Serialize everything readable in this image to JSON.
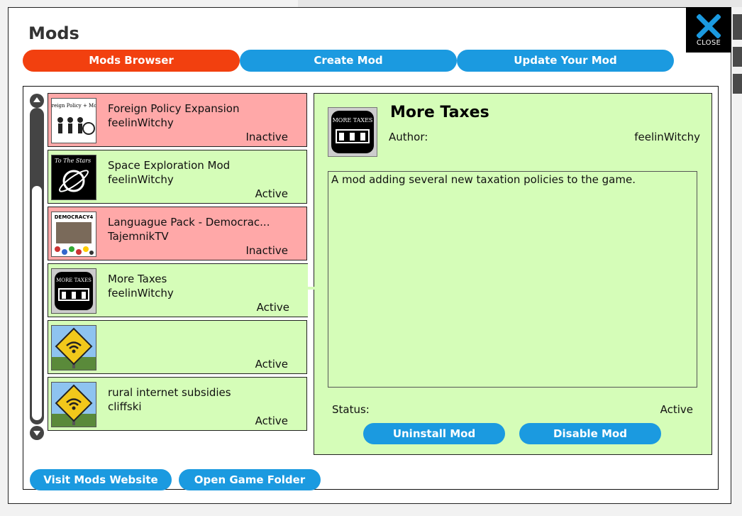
{
  "title": "Mods",
  "close": {
    "label": "CLOSE",
    "icon": "close-x-icon"
  },
  "tabs": [
    {
      "label": "Mods Browser",
      "active": true
    },
    {
      "label": "Create Mod",
      "active": false
    },
    {
      "label": "Update Your Mod",
      "active": false
    }
  ],
  "mods": [
    {
      "name": "Foreign Policy Expansion",
      "author": "feelinWitchy",
      "status": "Inactive",
      "icon": "foreign-policy-thumbnail"
    },
    {
      "name": "Space Exploration Mod",
      "author": "feelinWitchy",
      "status": "Active",
      "icon": "to-the-stars-thumbnail"
    },
    {
      "name": "Languague Pack - Democrac...",
      "author": "TajemnikTV",
      "status": "Inactive",
      "icon": "democracy-4-thumbnail"
    },
    {
      "name": "More Taxes",
      "author": "feelinWitchy",
      "status": "Active",
      "icon": "more-taxes-thumbnail"
    },
    {
      "name": "",
      "author": "",
      "status": "Active",
      "icon": "wifi-sign-thumbnail"
    },
    {
      "name": "rural internet subsidies",
      "author": "cliffski",
      "status": "Active",
      "icon": "wifi-sign-thumbnail"
    }
  ],
  "details": {
    "title": "More Taxes",
    "author_label": "Author:",
    "author": "feelinWitchy",
    "description": "A mod adding several new taxation policies to the game.",
    "status_label": "Status:",
    "status": "Active",
    "uninstall_label": "Uninstall Mod",
    "disable_label": "Disable Mod",
    "thumbnail_text": "MORE TAXES"
  },
  "footer": {
    "visit_label": "Visit Mods Website",
    "open_folder_label": "Open Game Folder"
  },
  "thumb_text": {
    "foreign_policy": "Foreign Policy + More",
    "stars": "To The Stars",
    "democracy": "DEMOCRACY4",
    "more_taxes": "MORE TAXES"
  },
  "colors": {
    "active_tab": "#f2400f",
    "button_blue": "#1b9ae0",
    "inactive_bg": "#ffa8a8",
    "active_bg": "#d5fdb8"
  }
}
